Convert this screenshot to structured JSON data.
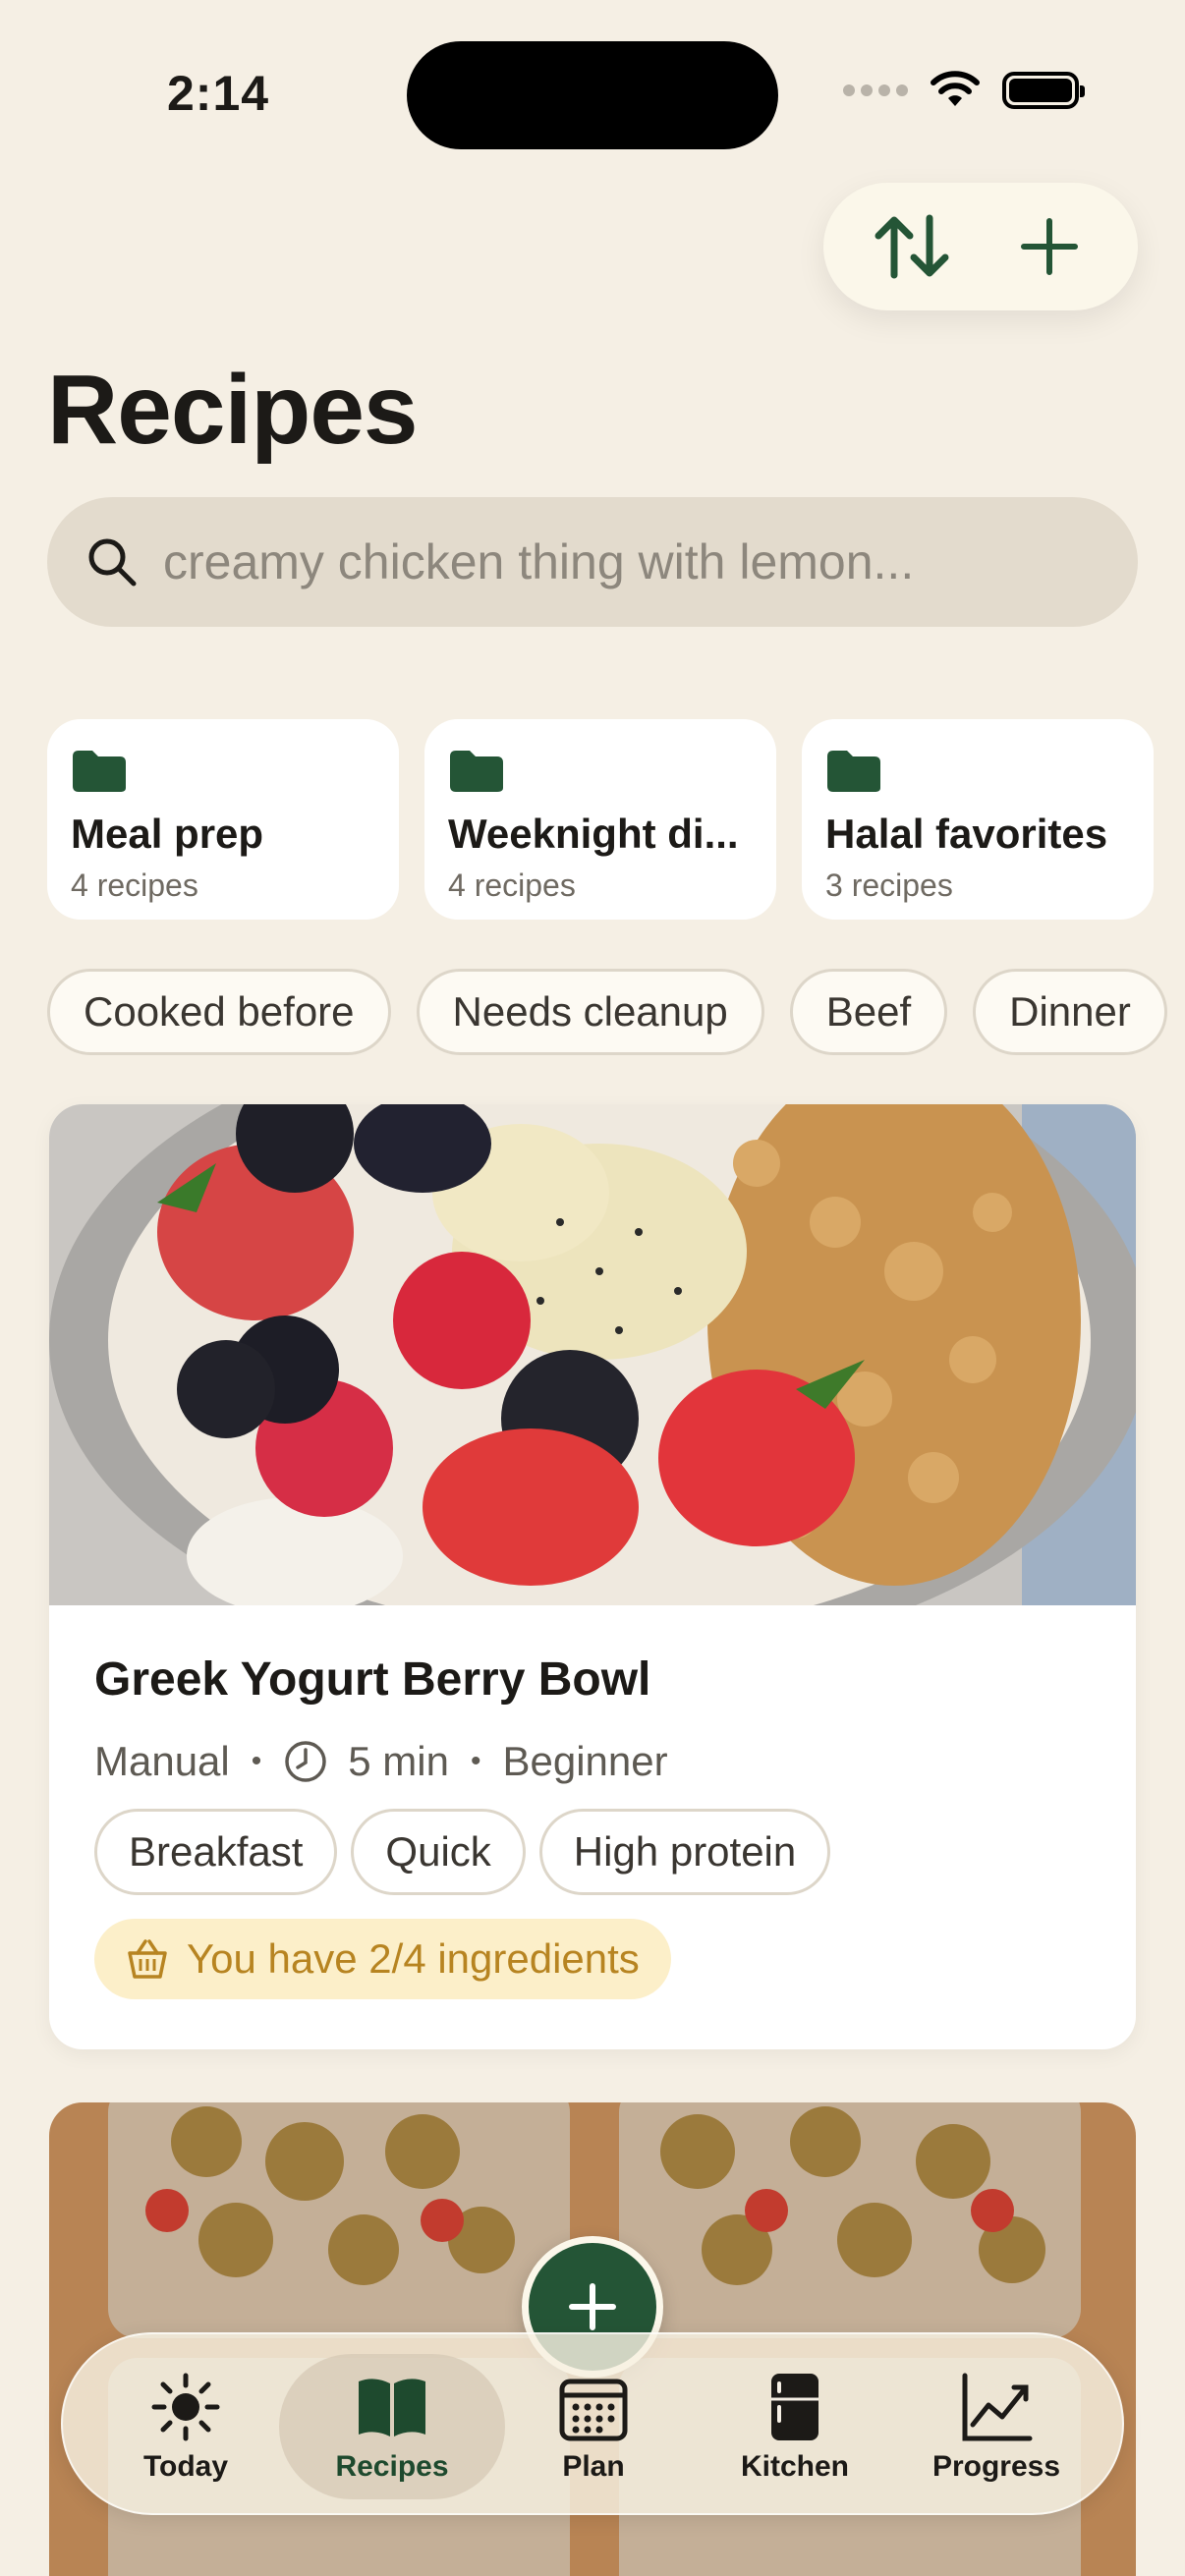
{
  "status_bar": {
    "time": "2:14"
  },
  "header": {
    "title": "Recipes",
    "sort_icon": "sort-arrows-icon",
    "add_icon": "plus-icon"
  },
  "search": {
    "placeholder": "creamy chicken thing with lemon..."
  },
  "folders": [
    {
      "name": "Meal prep",
      "count": "4 recipes"
    },
    {
      "name": "Weeknight di...",
      "count": "4 recipes"
    },
    {
      "name": "Halal favorites",
      "count": "3 recipes"
    }
  ],
  "filters": [
    "Cooked before",
    "Needs cleanup",
    "Beef",
    "Dinner"
  ],
  "recipe_card": {
    "title": "Greek Yogurt Berry Bowl",
    "source": "Manual",
    "time": "5 min",
    "difficulty": "Beginner",
    "tags": [
      "Breakfast",
      "Quick",
      "High protein"
    ],
    "ingredients_status": "You have 2/4 ingredients"
  },
  "tabs": [
    {
      "label": "Today",
      "icon": "sun-icon"
    },
    {
      "label": "Recipes",
      "icon": "book-icon",
      "active": true
    },
    {
      "label": "Plan",
      "icon": "calendar-icon"
    },
    {
      "label": "Kitchen",
      "icon": "fridge-icon"
    },
    {
      "label": "Progress",
      "icon": "chart-icon"
    }
  ],
  "colors": {
    "background": "#f5efe4",
    "accent_green": "#245536",
    "ingredient_badge_bg": "#fcefc9",
    "ingredient_badge_text": "#b78421"
  }
}
